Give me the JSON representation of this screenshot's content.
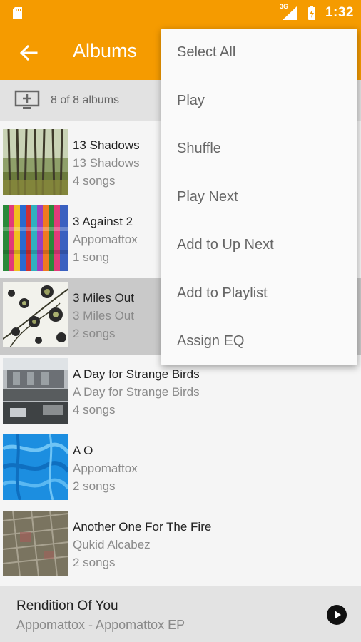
{
  "status_bar": {
    "network": "3G",
    "time": "1:32"
  },
  "app_bar": {
    "title": "Albums"
  },
  "header": {
    "count_text": "8 of 8 albums"
  },
  "albums": [
    {
      "title": "13 Shadows",
      "artist": "13 Shadows",
      "songs": "4 songs"
    },
    {
      "title": "3 Against 2",
      "artist": "Appomattox",
      "songs": "1 song"
    },
    {
      "title": "3 Miles Out",
      "artist": "3 Miles Out",
      "songs": "2 songs"
    },
    {
      "title": "A Day for Strange Birds",
      "artist": "A Day for Strange Birds",
      "songs": "4 songs"
    },
    {
      "title": "A O",
      "artist": "Appomattox",
      "songs": "2 songs"
    },
    {
      "title": "Another One For The Fire",
      "artist": "Qukid Alcabez",
      "songs": "2 songs"
    }
  ],
  "now_playing": {
    "title": "Rendition Of You",
    "subtitle": "Appomattox - Appomattox EP"
  },
  "menu": {
    "items": [
      "Select All",
      "Play",
      "Shuffle",
      "Play Next",
      "Add to Up Next",
      "Add to Playlist",
      "Assign EQ"
    ]
  },
  "colors": {
    "accent": "#f59b00",
    "selected_row": "#c9c9c9"
  }
}
